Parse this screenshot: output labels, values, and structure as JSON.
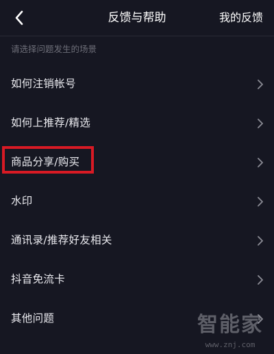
{
  "header": {
    "title": "反馈与帮助",
    "back_icon": "chevron-left-icon",
    "my_feedback": "我的反馈"
  },
  "section": {
    "hint": "请选择问题发生的场景"
  },
  "items": [
    {
      "label": "如何注销帐号"
    },
    {
      "label": "如何上推荐/精选"
    },
    {
      "label": "商品分享/购买"
    },
    {
      "label": "水印"
    },
    {
      "label": "通讯录/推荐好友相关"
    },
    {
      "label": "抖音免流卡"
    },
    {
      "label": "其他问题"
    }
  ],
  "watermark": {
    "text": "智能家",
    "url": "www.znj.com"
  },
  "colors": {
    "background": "#161722",
    "highlight": "#d81a24",
    "hint_text": "#6d6e78"
  }
}
